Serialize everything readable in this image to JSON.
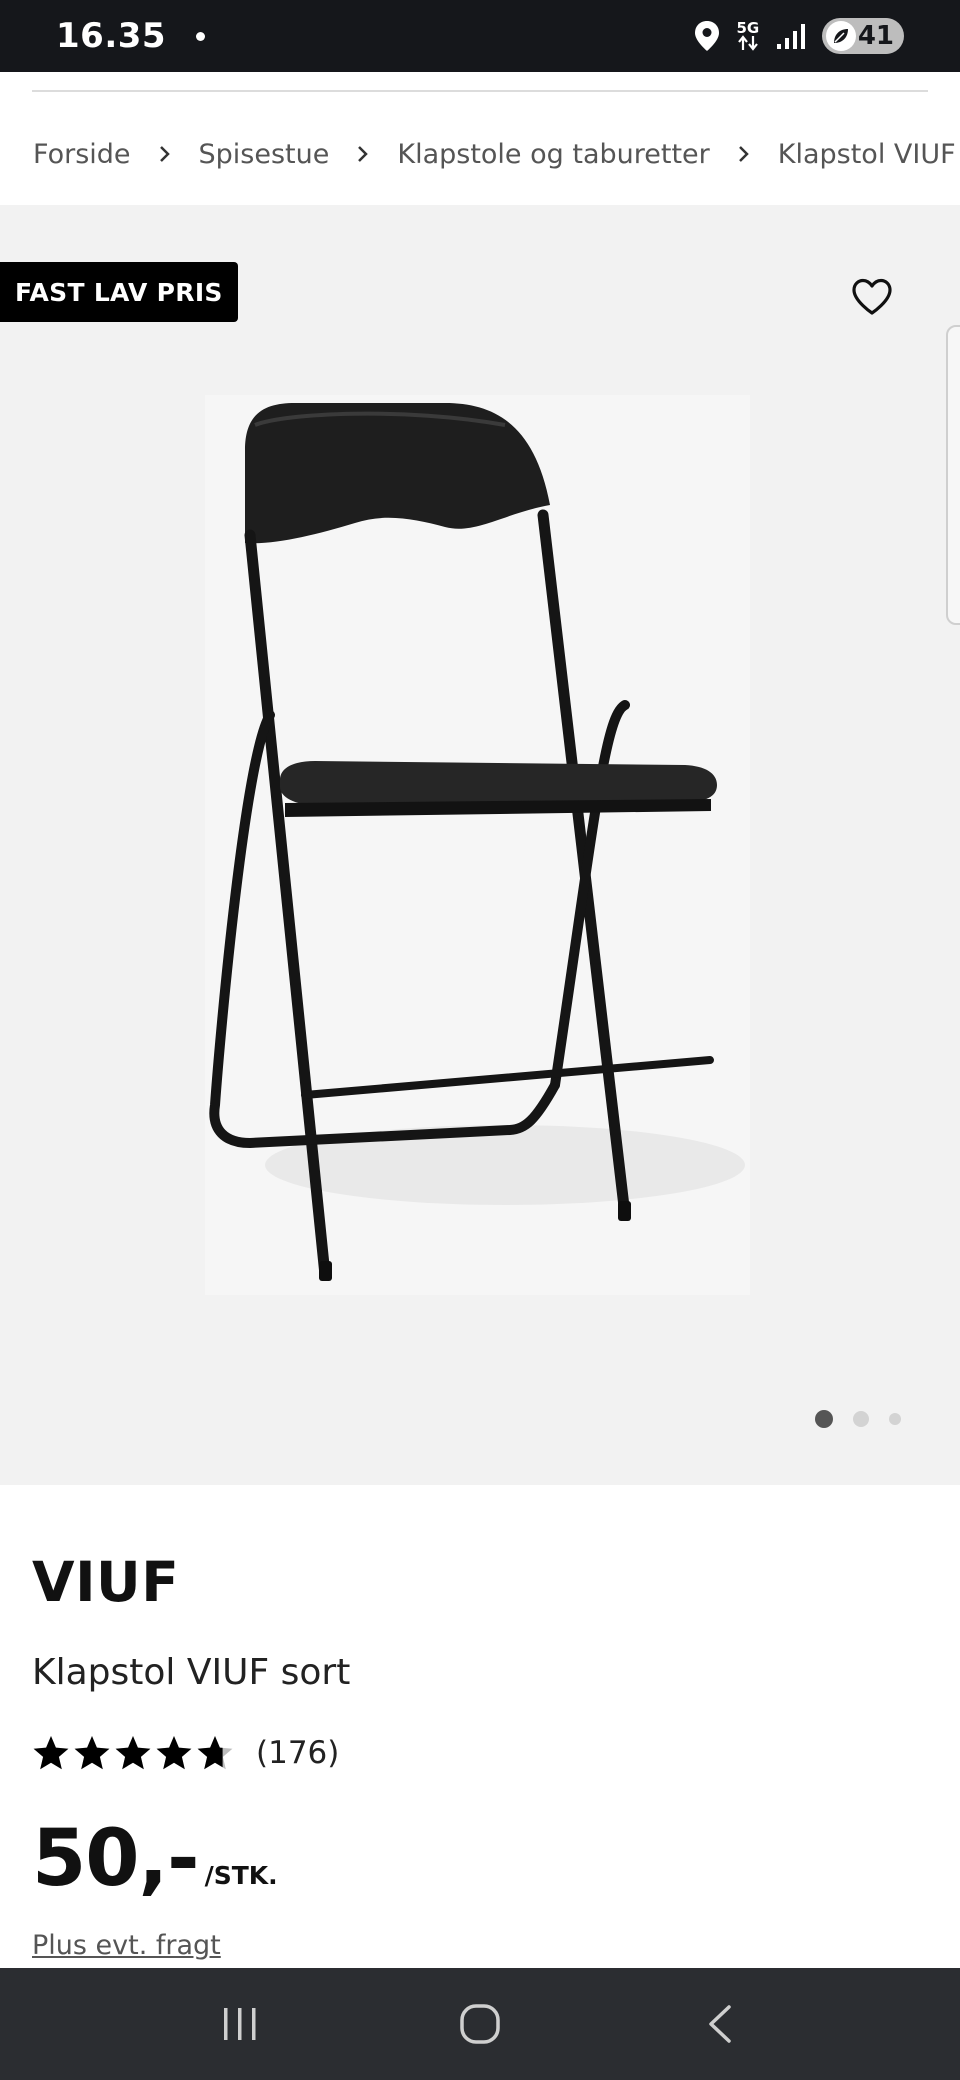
{
  "status_bar": {
    "time": "16.35",
    "network_label": "5G",
    "battery_level": "41",
    "icons": [
      "notification-dot-icon",
      "location-icon",
      "5g-data-icon",
      "signal-icon",
      "battery-saver-icon"
    ]
  },
  "breadcrumb": {
    "items": [
      "Forside",
      "Spisestue",
      "Klapstole og taburetter",
      "Klapstol VIUF sort"
    ]
  },
  "product_image": {
    "badge": "FAST LAV PRIS",
    "slides_total": 3,
    "slide_active": 1
  },
  "product": {
    "brand": "VIUF",
    "name": "Klapstol VIUF sort",
    "rating": 4.7,
    "rating_max": 5,
    "review_count": "(176)",
    "price": "50,-",
    "price_unit": "/STK.",
    "shipping_link": "Plus evt. fragt"
  },
  "colors": {
    "status_bar_bg": "#15171b",
    "image_bg": "#f2f2f2",
    "badge_bg": "#000000",
    "nav_bar_bg": "#2b2d31"
  },
  "nav_bar": {
    "icons": [
      "recent-apps-icon",
      "home-icon",
      "back-icon"
    ]
  }
}
